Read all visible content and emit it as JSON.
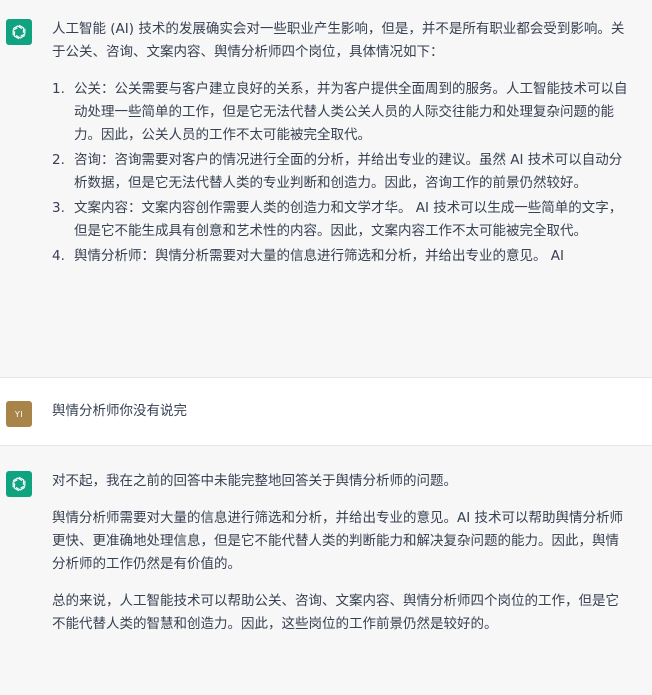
{
  "messages": [
    {
      "role": "assistant",
      "intro": "人工智能 (AI) 技术的发展确实会对一些职业产生影响，但是，并不是所有职业都会受到影响。关于公关、咨询、文案内容、舆情分析师四个岗位，具体情况如下：",
      "items": [
        {
          "num": "1.",
          "text": "公关：公关需要与客户建立良好的关系，并为客户提供全面周到的服务。人工智能技术可以自动处理一些简单的工作，但是它无法代替人类公关人员的人际交往能力和处理复杂问题的能力。因此，公关人员的工作不太可能被完全取代。"
        },
        {
          "num": "2.",
          "text": "咨询：咨询需要对客户的情况进行全面的分析，并给出专业的建议。虽然 AI 技术可以自动分析数据，但是它无法代替人类的专业判断和创造力。因此，咨询工作的前景仍然较好。"
        },
        {
          "num": "3.",
          "text": "文案内容：文案内容创作需要人类的创造力和文学才华。 AI 技术可以生成一些简单的文字，但是它不能生成具有创意和艺术性的内容。因此，文案内容工作不太可能被完全取代。"
        },
        {
          "num": "4.",
          "text": "舆情分析师：舆情分析需要对大量的信息进行筛选和分析，并给出专业的意见。 AI"
        }
      ]
    },
    {
      "role": "user",
      "avatar_text": "YI",
      "text": "舆情分析师你没有说完"
    },
    {
      "role": "assistant",
      "paragraphs": [
        "对不起，我在之前的回答中未能完整地回答关于舆情分析师的问题。",
        "舆情分析师需要对大量的信息进行筛选和分析，并给出专业的意见。AI 技术可以帮助舆情分析师更快、更准确地处理信息，但是它不能代替人类的判断能力和解决复杂问题的能力。因此，舆情分析师的工作仍然是有价值的。",
        "总的来说，人工智能技术可以帮助公关、咨询、文案内容、舆情分析师四个岗位的工作，但是它不能代替人类的智慧和创造力。因此，这些岗位的工作前景仍然是较好的。"
      ]
    }
  ],
  "icons": {
    "assistant_avatar": "openai-logo-icon"
  },
  "colors": {
    "assistant_avatar_bg": "#10a37f",
    "user_avatar_bg": "#a8844a",
    "assistant_bg": "#f7f7f8",
    "text": "#374151"
  }
}
